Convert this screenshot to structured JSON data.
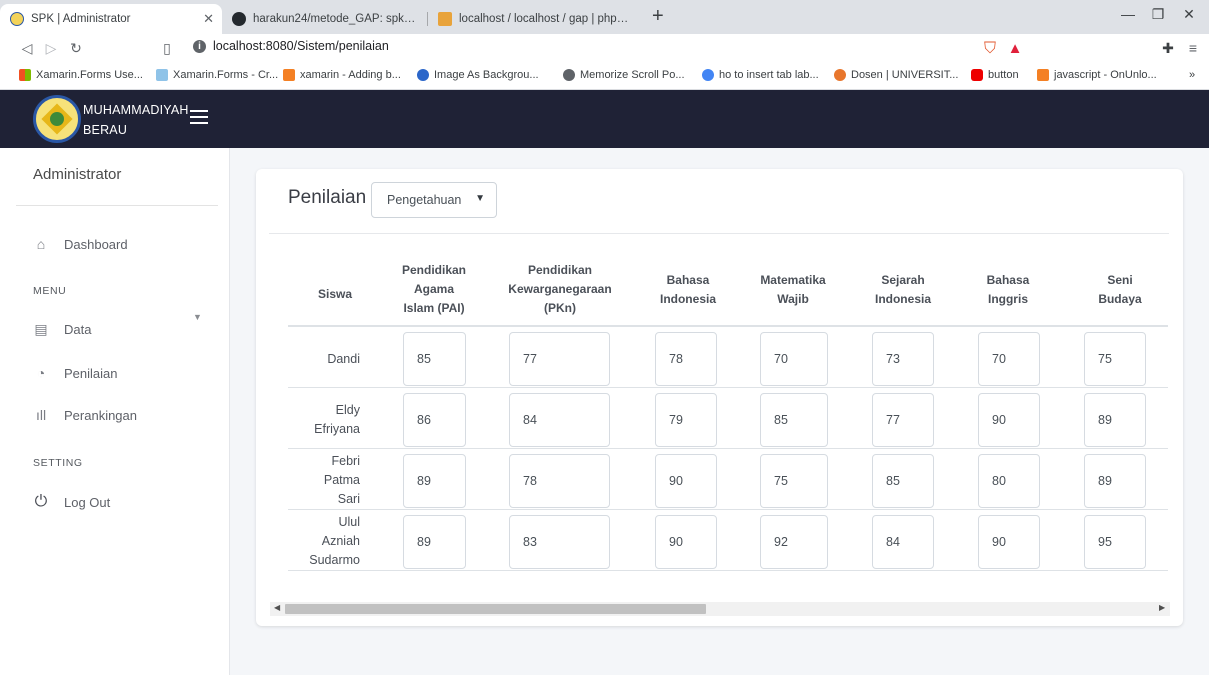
{
  "browser": {
    "tabs": [
      {
        "title": "SPK | Administrator",
        "active": true
      },
      {
        "title": "harakun24/metode_GAP: spk menggu",
        "active": false
      },
      {
        "title": "localhost / localhost / gap | phpMyAd",
        "active": false
      }
    ],
    "new_tab": "+",
    "address": "localhost:8080/Sistem/penilaian",
    "bookmarks": [
      "Xamarin.Forms Use...",
      "Xamarin.Forms - Cr...",
      "xamarin - Adding b...",
      "Image As Backgrou...",
      "Memorize Scroll Po...",
      "ho to insert tab lab...",
      "Dosen | UNIVERSIT...",
      "button",
      "javascript - OnUnlo..."
    ]
  },
  "app": {
    "brand_line1": "MUHAMMADIYAH",
    "brand_line2": "BERAU"
  },
  "sidebar": {
    "user": "Administrator",
    "menu_section": "MENU",
    "setting_section": "SETTING",
    "items": {
      "dashboard": "Dashboard",
      "data": "Data",
      "penilaian": "Penilaian",
      "perankingan": "Perankingan",
      "logout": "Log Out"
    }
  },
  "main": {
    "title": "Penilaian",
    "select_value": "Pengetahuan",
    "columns": [
      [
        "Siswa"
      ],
      [
        "Pendidikan",
        "Agama",
        "Islam (PAI)"
      ],
      [
        "Pendidikan",
        "Kewarganegaraan",
        "(PKn)"
      ],
      [
        "Bahasa",
        "Indonesia"
      ],
      [
        "Matematika",
        "Wajib"
      ],
      [
        "Sejarah",
        "Indonesia"
      ],
      [
        "Bahasa",
        "Inggris"
      ],
      [
        "Seni",
        "Budaya"
      ]
    ],
    "rows": [
      {
        "name": [
          "Dandi"
        ],
        "scores": [
          "85",
          "77",
          "78",
          "70",
          "73",
          "70",
          "75"
        ]
      },
      {
        "name": [
          "Eldy",
          "Efriyana"
        ],
        "scores": [
          "86",
          "84",
          "79",
          "85",
          "77",
          "90",
          "89"
        ]
      },
      {
        "name": [
          "Febri",
          "Patma",
          "Sari"
        ],
        "scores": [
          "89",
          "78",
          "90",
          "75",
          "85",
          "80",
          "89"
        ]
      },
      {
        "name": [
          "Ulul",
          "Azniah",
          "Sudarmo"
        ],
        "scores": [
          "89",
          "83",
          "90",
          "92",
          "84",
          "90",
          "95"
        ]
      }
    ]
  }
}
